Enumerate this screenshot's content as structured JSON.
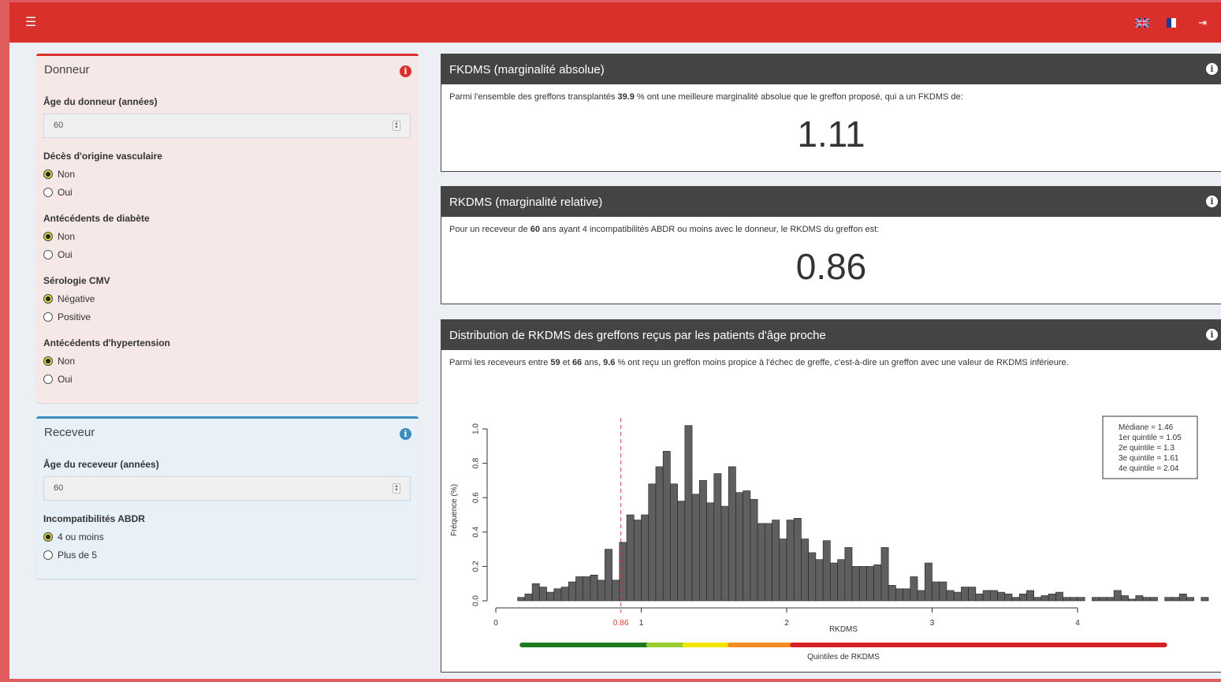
{
  "topbar": {
    "menu_icon": "hamburger-icon",
    "lang_en": "flag-uk-icon",
    "lang_fr": "flag-fr-icon",
    "logout_icon": "logout-icon",
    "color": "#d9302b"
  },
  "donneur": {
    "title": "Donneur",
    "age_label": "Âge du donneur (années)",
    "age_value": "60",
    "vascular_label": "Décès d'origine vasculaire",
    "vascular_options": [
      "Non",
      "Oui"
    ],
    "vascular_selected": "Non",
    "diabete_label": "Antécédents de diabète",
    "diabete_options": [
      "Non",
      "Oui"
    ],
    "diabete_selected": "Non",
    "cmv_label": "Sérologie CMV",
    "cmv_options": [
      "Négative",
      "Positive"
    ],
    "cmv_selected": "Négative",
    "hta_label": "Antécédents d'hypertension",
    "hta_options": [
      "Non",
      "Oui"
    ],
    "hta_selected": "Non"
  },
  "receveur": {
    "title": "Receveur",
    "age_label": "Âge du receveur (années)",
    "age_value": "60",
    "abdr_label": "Incompatibilités ABDR",
    "abdr_options": [
      "4 ou moins",
      "Plus de 5"
    ],
    "abdr_selected": "4 ou moins"
  },
  "fkdms": {
    "title": "FKDMS (marginalité absolue)",
    "text_before": "Parmi l'ensemble des greffons transplantés ",
    "percent": "39.9",
    "text_after": " % ont une meilleure marginalité absolue que le greffon proposé, qui a un FKDMS de:",
    "value": "1.11"
  },
  "rkdms": {
    "title": "RKDMS (marginalité relative)",
    "text_before": "Pour un receveur de ",
    "age": "60",
    "text_after": " ans ayant 4 incompatibilités ABDR ou moins avec le donneur, le RKDMS du greffon est:",
    "value": "0.86"
  },
  "distribution": {
    "title": "Distribution de RKDMS des greffons reçus par les patients d'âge proche",
    "t1": "Parmi les receveurs entre ",
    "age_min": "59",
    "t2": " et ",
    "age_max": "66",
    "t3": " ans, ",
    "percent": "9.6",
    "t4": " % ont reçu un greffon moins propice à l'échec de greffe, c'est-à-dire un greffon avec une valeur de RKDMS inférieure."
  },
  "chart_data": {
    "type": "bar",
    "xlabel": "RKDMS",
    "ylabel": "Fréquence (%)",
    "xlim": [
      0,
      4.7
    ],
    "ylim": [
      0,
      1.0
    ],
    "x_ticks": [
      "0",
      "1",
      "2",
      "3",
      "4"
    ],
    "y_ticks": [
      "0.0",
      "0.2",
      "0.4",
      "0.6",
      "0.8",
      "1.0"
    ],
    "bin_width": 0.05,
    "bin_start": 0.15,
    "values": [
      0.02,
      0.04,
      0.1,
      0.08,
      0.05,
      0.07,
      0.08,
      0.11,
      0.14,
      0.14,
      0.15,
      0.12,
      0.3,
      0.12,
      0.34,
      0.5,
      0.47,
      0.5,
      0.68,
      0.78,
      0.87,
      0.68,
      0.58,
      1.02,
      0.62,
      0.7,
      0.57,
      0.74,
      0.55,
      0.78,
      0.63,
      0.64,
      0.59,
      0.45,
      0.45,
      0.47,
      0.36,
      0.47,
      0.48,
      0.36,
      0.28,
      0.24,
      0.35,
      0.22,
      0.24,
      0.31,
      0.2,
      0.2,
      0.2,
      0.21,
      0.31,
      0.09,
      0.07,
      0.07,
      0.14,
      0.06,
      0.22,
      0.11,
      0.11,
      0.06,
      0.05,
      0.08,
      0.08,
      0.04,
      0.06,
      0.06,
      0.05,
      0.04,
      0.02,
      0.04,
      0.06,
      0.02,
      0.03,
      0.04,
      0.05,
      0.02,
      0.02,
      0.02,
      0.0,
      0.02,
      0.02,
      0.02,
      0.06,
      0.03,
      0.01,
      0.03,
      0.02,
      0.02,
      0.0,
      0.02,
      0.02,
      0.04,
      0.02,
      0.0,
      0.02
    ],
    "marker_value": 0.86,
    "marker_label": "0.86",
    "legend": [
      "Médiane = 1.46",
      "1er quintile = 1.05",
      "2e quintile = 1.3",
      "3e quintile = 1.61",
      "4e quintile = 2.04"
    ],
    "quintile_bar_label": "Quintiles de RKDMS",
    "quintile_segments": [
      {
        "from": 0.18,
        "to": 1.05,
        "color": "#1f7a1f"
      },
      {
        "from": 1.05,
        "to": 1.3,
        "color": "#9acd32"
      },
      {
        "from": 1.3,
        "to": 1.61,
        "color": "#f2e600"
      },
      {
        "from": 1.61,
        "to": 2.04,
        "color": "#f28c1f"
      },
      {
        "from": 2.04,
        "to": 4.6,
        "color": "#d62027"
      }
    ],
    "bar_color": "#5f5f5f",
    "marker_color": "#e0393c"
  }
}
